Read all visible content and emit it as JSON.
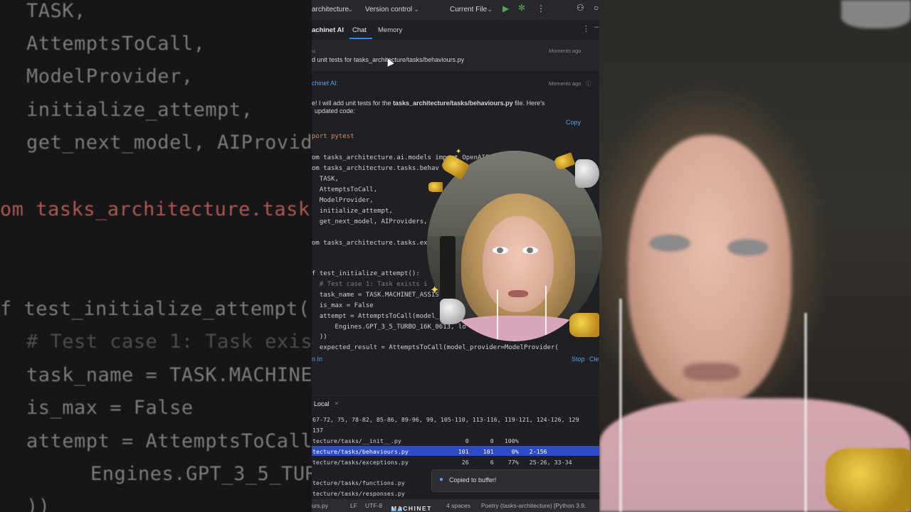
{
  "background_left": {
    "lines": [
      {
        "text": "TASK,",
        "cls": ""
      },
      {
        "text": "AttemptsToCall,",
        "cls": ""
      },
      {
        "text": "ModelProvider,",
        "cls": ""
      },
      {
        "text": "initialize_attempt,",
        "cls": ""
      },
      {
        "text": "get_next_model, AIProvid",
        "cls": ""
      },
      {
        "text": "om tasks_architecture.task",
        "cls": "kw"
      },
      {
        "text": "f test_initialize_attempt(",
        "cls": ""
      },
      {
        "text": "# Test case 1: Task exis",
        "cls": "cm"
      },
      {
        "text": "task_name = TASK.MACHINE",
        "cls": ""
      },
      {
        "text": "is_max = False",
        "cls": ""
      },
      {
        "text": "attempt = AttemptsToCall",
        "cls": ""
      },
      {
        "text": "    Engines.GPT_3_5_TURB",
        "cls": ""
      },
      {
        "text": "))",
        "cls": ""
      }
    ]
  },
  "toolbar": {
    "project": "architecture",
    "vcs": "Version control",
    "run_config": "Current File"
  },
  "tabs": {
    "plugin": "achinet AI",
    "chat": "Chat",
    "memory": "Memory"
  },
  "chat": {
    "user_label": "u:",
    "user_time": "Moments ago",
    "user_message": "d unit tests for tasks_architecture/tasks/behaviours.py",
    "ai_label": "chinet AI:",
    "ai_time": "Moments ago",
    "ai_intro_1": "e! I will add unit tests for the ",
    "ai_intro_file": "tasks_architecture/tasks/behaviours.py",
    "ai_intro_2": " file. Here's",
    "ai_intro_3": "updated code:",
    "copy_label": "Copy",
    "stop_label": "Stop",
    "clear_label": "Cle",
    "insert_label": "n In"
  },
  "code_lines": [
    "port pytest",
    "",
    "om tasks_architecture.ai.models import OpenAIE",
    "om tasks_architecture.tasks.behav",
    "  TASK,",
    "  AttemptsToCall,",
    "  ModelProvider,",
    "  initialize_attempt,",
    "  get_next_model, AIProviders,",
    "",
    "om tasks_architecture.tasks.ex",
    "",
    "",
    "f test_initialize_attempt():",
    "  # Test case 1: Task exists i",
    "  task_name = TASK.MACHINET_ASSIS",
    "  is_max = False",
    "  attempt = AttemptsToCall(model_",
    "      Engines.GPT_3_5_TURBO_16K_0613, lo",
    "  ))",
    "  expected_result = AttemptsToCall(model_provider=ModelProvider("
  ],
  "bottom_panel": {
    "tab": "Local",
    "rows": [
      "67-72, 75, 78-82, 85-86, 89-96, 99, 105-110, 113-116, 119-121, 124-126, 129",
      "137",
      "tecture/tasks/__init__.py                  0      0   100%",
      "tecture/tasks/behaviours.py              101    101     0%   2-156",
      "tecture/tasks/exceptions.py               26      6    77%   25-26, 33-34",
      "",
      "tecture/tasks/functions.py",
      "tecture/tasks/responses.py"
    ]
  },
  "toast": {
    "text": "Copied to buffer!"
  },
  "statusbar": {
    "file": "urs.py",
    "line_sep": "LF",
    "encoding": "UTF-8",
    "brand": "MACHINET",
    "indent": "4 spaces",
    "interpreter": "Poetry (tasks-architecture) [Python 3.9."
  },
  "colors": {
    "accent": "#3b82f6",
    "selection": "#2e4cc7",
    "link": "#5b9cf5"
  }
}
